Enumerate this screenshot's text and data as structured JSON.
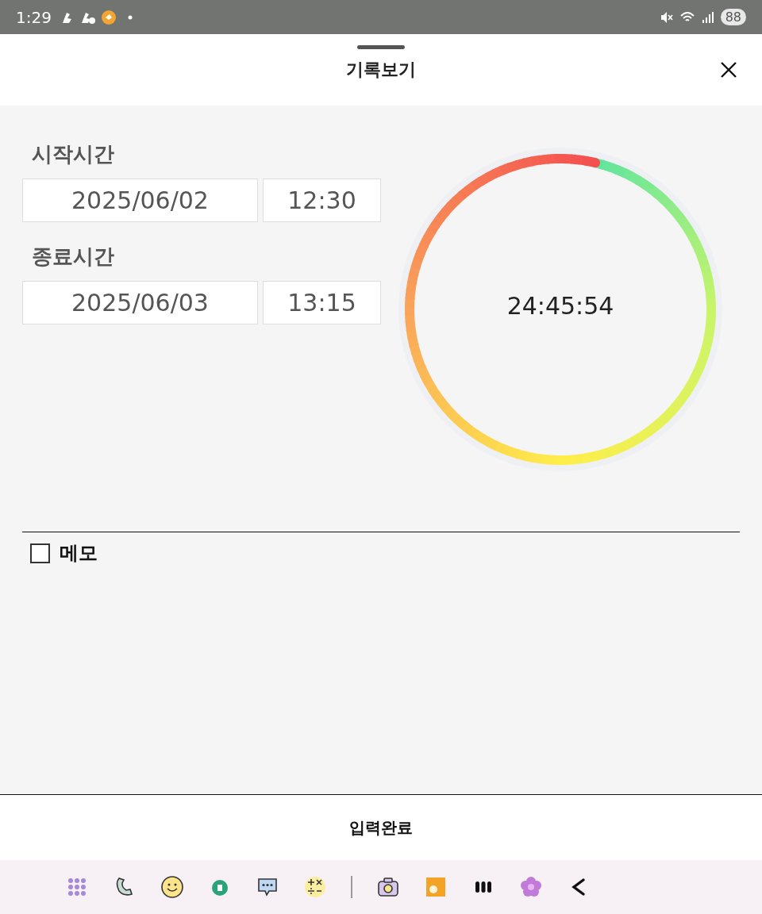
{
  "status_bar": {
    "time": "1:29",
    "battery": "88"
  },
  "header": {
    "title": "기록보기"
  },
  "start": {
    "label": "시작시간",
    "date": "2025/06/02",
    "time": "12:30"
  },
  "end": {
    "label": "종료시간",
    "date": "2025/06/03",
    "time": "13:15"
  },
  "timer": {
    "elapsed": "24:45:54"
  },
  "memo": {
    "label": "메모",
    "checked": false
  },
  "submit_button": "입력완료"
}
